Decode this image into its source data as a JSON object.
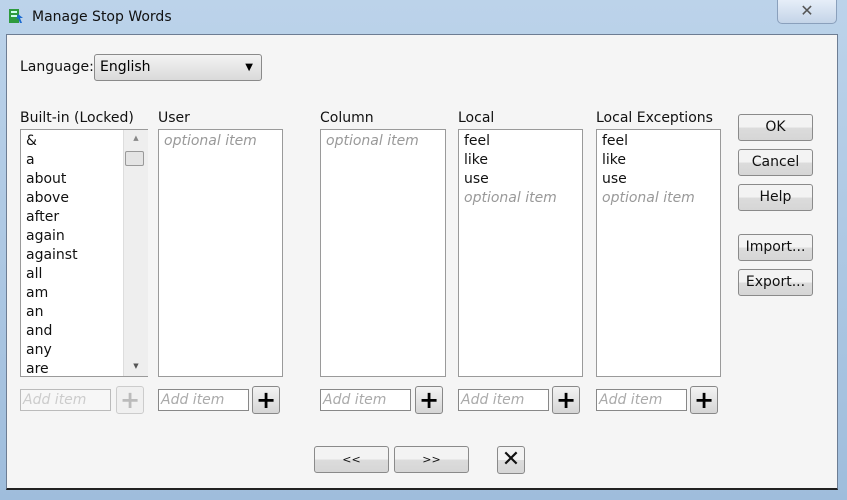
{
  "window": {
    "title": "Manage Stop Words",
    "close": "✕"
  },
  "language": {
    "label": "Language:",
    "value": "English"
  },
  "lists": {
    "builtin": {
      "label": "Built-in (Locked)",
      "items": [
        "&",
        "a",
        "about",
        "above",
        "after",
        "again",
        "against",
        "all",
        "am",
        "an",
        "and",
        "any",
        "are"
      ]
    },
    "user": {
      "label": "User",
      "placeholder": "optional item"
    },
    "column": {
      "label": "Column",
      "placeholder": "optional item"
    },
    "local": {
      "label": "Local",
      "items": [
        "feel",
        "like",
        "use"
      ],
      "placeholder": "optional item"
    },
    "local_exceptions": {
      "label": "Local Exceptions",
      "items": [
        "feel",
        "like",
        "use"
      ],
      "placeholder": "optional item"
    }
  },
  "add_placeholder": "Add item",
  "buttons": {
    "ok": "OK",
    "cancel": "Cancel",
    "help": "Help",
    "import": "Import...",
    "export": "Export...",
    "prev": "<<",
    "next": ">>",
    "clear": "✕"
  }
}
